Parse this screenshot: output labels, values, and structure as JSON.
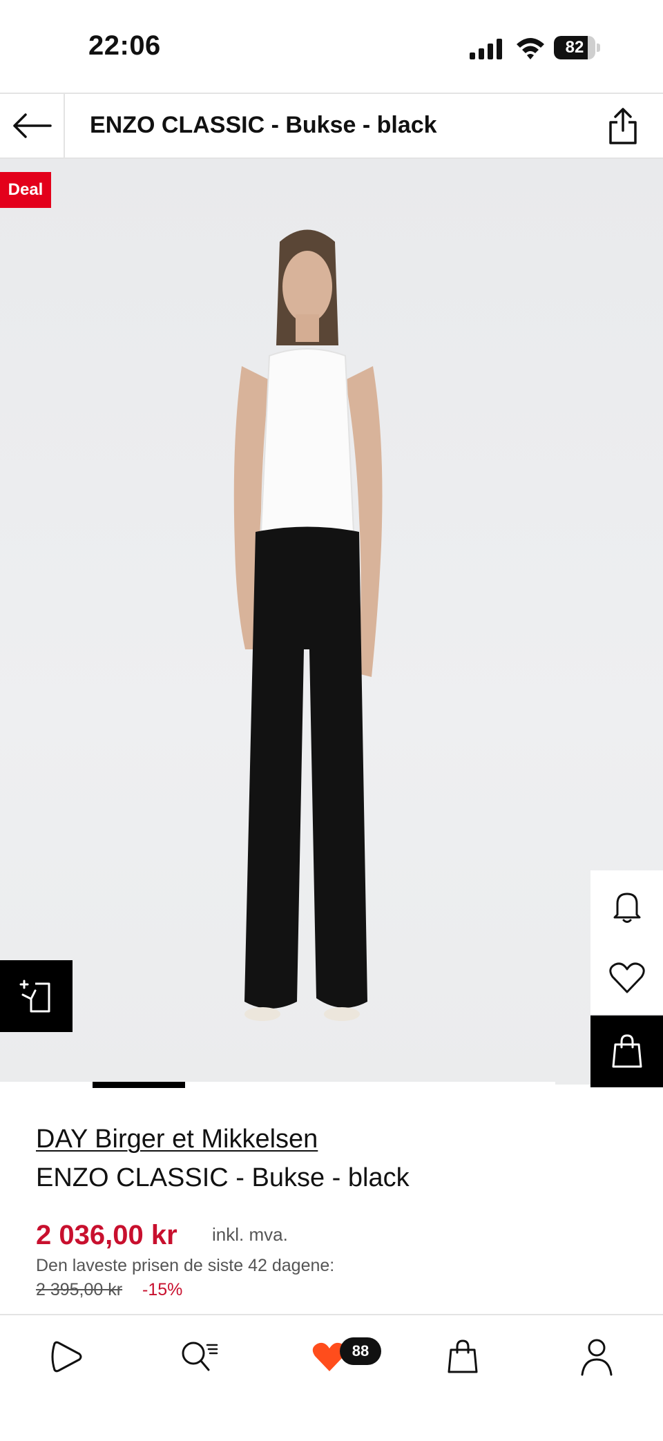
{
  "status_bar": {
    "time": "22:06",
    "battery": "82",
    "battery_level": 0.82,
    "icons": [
      "signal-icon",
      "wifi-icon",
      "battery-icon"
    ]
  },
  "header": {
    "title": "ENZO CLASSIC - Bukse - black",
    "back_icon": "arrow-left-icon",
    "share_icon": "share-icon"
  },
  "product": {
    "badge": "Deal",
    "brand": "DAY Birger et Mikkelsen",
    "name": "ENZO CLASSIC - Bukse - black",
    "price": "2 036,00 kr",
    "vat_label": "inkl. mva.",
    "lowest_price_label": "Den laveste prisen de siste 42 dagene:",
    "old_price": "2 395,00 kr",
    "discount": "-15%",
    "image_actions": [
      "bell-icon",
      "heart-icon",
      "shopping-bag-icon"
    ],
    "similar_icon": "similar-items-icon"
  },
  "carousel": {
    "active_index": 1
  },
  "bottom_nav": {
    "items": [
      {
        "name": "home",
        "icon": "play-shape-icon"
      },
      {
        "name": "search",
        "icon": "search-list-icon"
      },
      {
        "name": "wishlist",
        "icon": "heart-icon"
      },
      {
        "name": "bag",
        "icon": "shopping-bag-icon"
      },
      {
        "name": "account",
        "icon": "user-icon"
      }
    ],
    "wishlist_count": "88"
  },
  "colors": {
    "accent_red": "#e3001b",
    "price_red": "#c8102e",
    "wishlist_orange": "#ff4d1c",
    "black": "#000000"
  }
}
